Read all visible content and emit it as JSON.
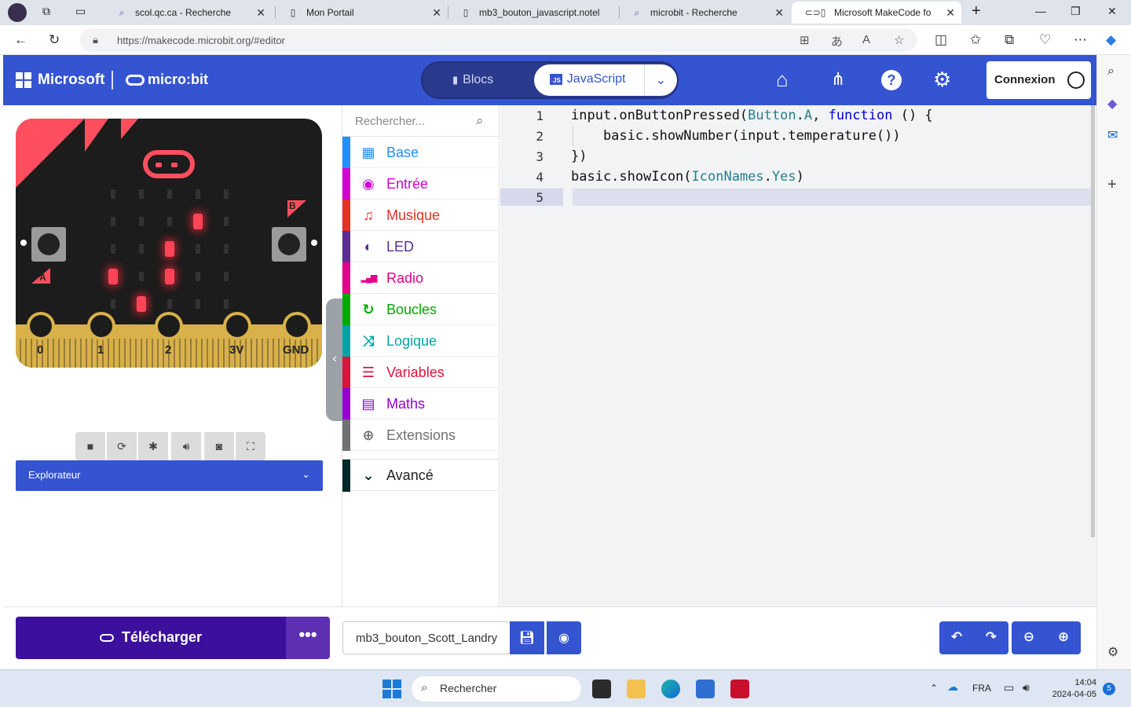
{
  "browser": {
    "tabs": [
      {
        "title": "scol.qc.ca - Recherche",
        "icon": "search-icon"
      },
      {
        "title": "Mon Portail",
        "icon": "page-icon"
      },
      {
        "title": "mb3_bouton_javascript.notel",
        "icon": "page-icon"
      },
      {
        "title": "microbit - Recherche",
        "icon": "search-icon"
      },
      {
        "title": "Microsoft MakeCode fo",
        "icon": "makecode-icon"
      }
    ],
    "url": "https://makecode.microbit.org/#editor"
  },
  "makecode": {
    "brand": {
      "microsoft": "Microsoft",
      "product": "micro:bit"
    },
    "editor_toggle": {
      "blocks": "Blocs",
      "javascript": "JavaScript",
      "js_badge": "JS"
    },
    "login": "Connexion",
    "simulator": {
      "pins": [
        "0",
        "1",
        "2",
        "3V",
        "GND"
      ],
      "button_labels": [
        "A",
        "B"
      ],
      "lit_leds": [
        [
          1,
          3
        ],
        [
          2,
          2
        ],
        [
          3,
          0
        ],
        [
          3,
          2
        ],
        [
          4,
          1
        ]
      ]
    },
    "explorer": "Explorateur",
    "toolbox": {
      "search_placeholder": "Rechercher...",
      "categories": [
        {
          "label": "Base",
          "color": "#1e90ff",
          "icon": "grid-icon"
        },
        {
          "label": "Entrée",
          "color": "#d400d4",
          "icon": "target-icon"
        },
        {
          "label": "Musique",
          "color": "#e63022",
          "icon": "headphones-icon"
        },
        {
          "label": "LED",
          "color": "#5c2d91",
          "icon": "toggle-icon"
        },
        {
          "label": "Radio",
          "color": "#e3008c",
          "icon": "signal-icon"
        },
        {
          "label": "Boucles",
          "color": "#00aa00",
          "icon": "loop-icon"
        },
        {
          "label": "Logique",
          "color": "#00a4a6",
          "icon": "shuffle-icon"
        },
        {
          "label": "Variables",
          "color": "#dc143c",
          "icon": "lines-icon"
        },
        {
          "label": "Maths",
          "color": "#9400d3",
          "icon": "calculator-icon"
        },
        {
          "label": "Extensions",
          "color": "#717171",
          "icon": "plus-circle-icon"
        }
      ],
      "advanced": "Avancé"
    },
    "code": {
      "line_numbers": [
        "1",
        "2",
        "3",
        "4",
        "5"
      ],
      "lines": [
        [
          {
            "t": "input.onButtonPressed("
          },
          {
            "t": "Button",
            "c": "ty"
          },
          {
            "t": "."
          },
          {
            "t": "A",
            "c": "ty"
          },
          {
            "t": ", "
          },
          {
            "t": "function",
            "c": "kw"
          },
          {
            "t": " () {"
          }
        ],
        [
          {
            "t": "    basic.showNumber(input.temperature())"
          }
        ],
        [
          {
            "t": "})"
          }
        ],
        [
          {
            "t": "basic.showIcon("
          },
          {
            "t": "IconNames",
            "c": "ty"
          },
          {
            "t": "."
          },
          {
            "t": "Yes",
            "c": "ty"
          },
          {
            "t": ")"
          }
        ],
        [
          {
            "t": ""
          }
        ]
      ]
    },
    "footer": {
      "download": "Télécharger",
      "more": "•••",
      "project_name": "mb3_bouton_Scott_Landry"
    }
  },
  "taskbar": {
    "search": "Rechercher",
    "language": "FRA",
    "time": "14:04",
    "date": "2024-04-05",
    "notifications": "5"
  }
}
